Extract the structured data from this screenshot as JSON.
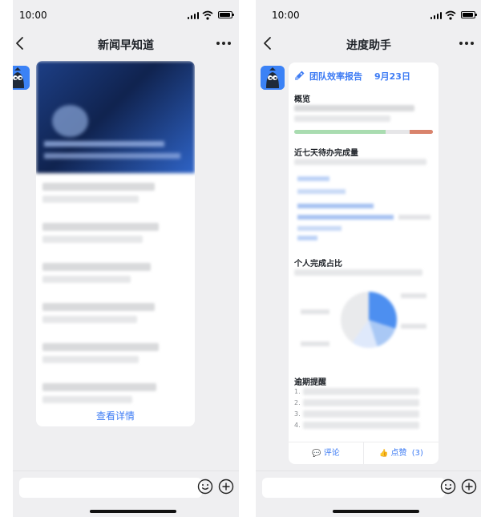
{
  "left_screen": {
    "status_time": "10:00",
    "title": "新闻早知道",
    "view_details_label": "查看详情",
    "input_placeholder": ""
  },
  "right_screen": {
    "status_time": "10:00",
    "title": "进度助手",
    "report": {
      "title": "团队效率报告",
      "date": "9月23日",
      "sections": {
        "overview": "概览",
        "pending_7d": "近七天待办完成量",
        "personal_ratio": "个人完成占比",
        "overdue": "逾期提醒"
      },
      "overdue_numbers": [
        "1.",
        "2.",
        "3.",
        "4."
      ],
      "comment_label": "评论",
      "like_label": "点赞",
      "like_count": "(3)"
    },
    "input_placeholder": ""
  },
  "icons": {
    "back": "chevron-left-icon",
    "more": "more-dots-icon",
    "emoji": "emoji-icon",
    "add": "add-circle-icon",
    "rocket": "rocket-icon",
    "comment": "comment-icon",
    "like": "thumbs-up-icon"
  },
  "colors": {
    "accent_blue": "#3e7cf4",
    "progress_green": "#a9dcb0",
    "progress_grey": "#e6e6e8",
    "progress_red": "#d9836c",
    "chat_background": "#efeff1"
  }
}
